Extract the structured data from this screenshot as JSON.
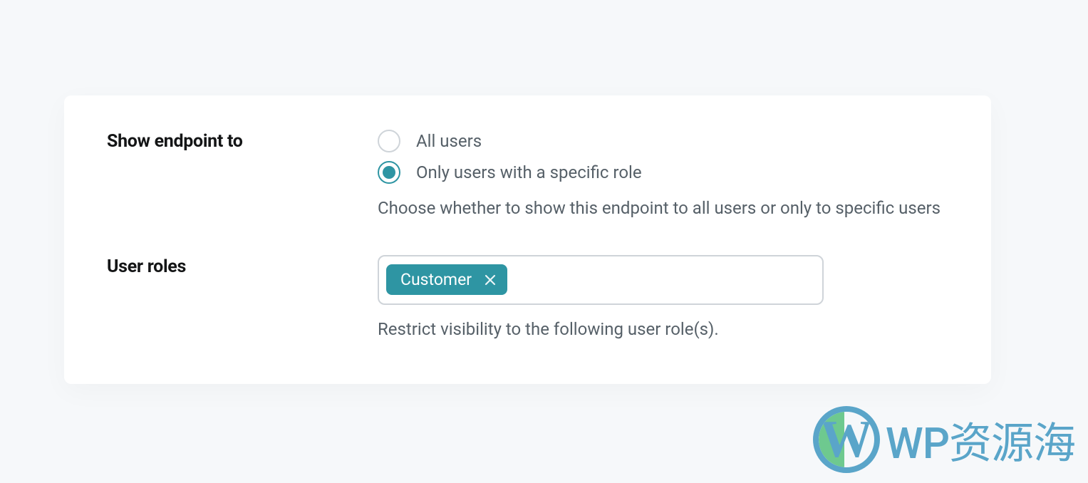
{
  "settings": {
    "show_endpoint": {
      "label": "Show endpoint to",
      "options": {
        "all": "All users",
        "specific": "Only users with a specific role"
      },
      "help": "Choose whether to show this endpoint to all users or only to specific users"
    },
    "user_roles": {
      "label": "User roles",
      "selected_tag": "Customer",
      "help": "Restrict visibility to the following user role(s)."
    }
  },
  "watermark": {
    "text": "WP资源海"
  }
}
